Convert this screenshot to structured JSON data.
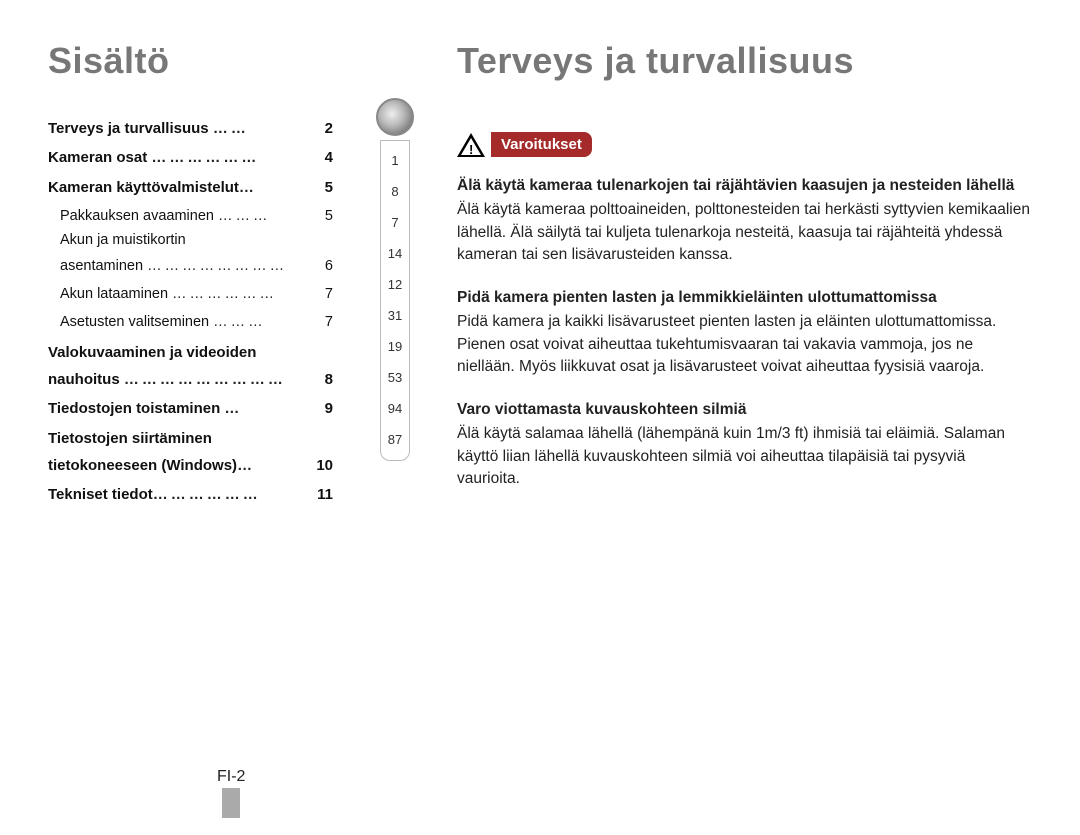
{
  "left_title": "Sisältö",
  "toc": {
    "item0": {
      "label": "Terveys ja turvallisuus",
      "page": "2"
    },
    "item1": {
      "label": "Kameran osat",
      "page": "4"
    },
    "item2": {
      "label": "Kameran käyttövalmistelut",
      "page": "5"
    },
    "item2a": {
      "label": "Pakkauksen avaaminen",
      "page": "5"
    },
    "item2b_line1": "Akun ja muistikortin",
    "item2b": {
      "label": "asentaminen",
      "page": "6"
    },
    "item2c": {
      "label": "Akun lataaminen",
      "page": "7"
    },
    "item2d": {
      "label": "Asetusten valitseminen",
      "page": "7"
    },
    "item3_line1": "Valokuvaaminen ja videoiden",
    "item3": {
      "label": "nauhoitus",
      "page": "8"
    },
    "item4": {
      "label": "Tiedostojen toistaminen",
      "page": "9"
    },
    "item5_line1": "Tietostojen siirtäminen",
    "item5": {
      "label": "tietokoneeseen (Windows)",
      "page": "10"
    },
    "item6": {
      "label": "Tekniset tiedot",
      "page": "11"
    }
  },
  "ref": [
    "1",
    "8",
    "7",
    "14",
    "12",
    "31",
    "19",
    "53",
    "94",
    "87"
  ],
  "right_title": "Terveys ja turvallisuus",
  "pill": "Varoitukset",
  "sec1_h": "Älä käytä kameraa tulenarkojen tai räjähtävien kaasujen ja nesteiden lähellä",
  "sec1_b": "Älä käytä kameraa polttoaineiden, polttonesteiden tai herkästi syttyvien kemikaalien lähellä. Älä säilytä tai kuljeta tulenarkoja nesteitä, kaasuja tai räjähteitä yhdessä kameran tai sen lisävarusteiden kanssa.",
  "sec2_h": "Pidä kamera pienten lasten ja lemmikkieläinten ulottumattomissa",
  "sec2_b": "Pidä kamera ja kaikki lisävarusteet pienten lasten ja eläinten ulottumattomissa. Pienen osat voivat aiheuttaa tukehtumisvaaran tai vakavia vammoja, jos ne niellään. Myös liikkuvat osat ja lisävarusteet voivat aiheuttaa fyysisiä vaaroja.",
  "sec3_h": "Varo viottamasta kuvauskohteen silmiä",
  "sec3_b": "Älä käytä salamaa lähellä (lähempänä kuin 1m/3 ft) ihmisiä tai eläimiä. Salaman käyttö liian lähellä kuvauskohteen silmiä voi aiheuttaa tilapäisiä tai pysyviä vaurioita.",
  "footer": "FI-2"
}
